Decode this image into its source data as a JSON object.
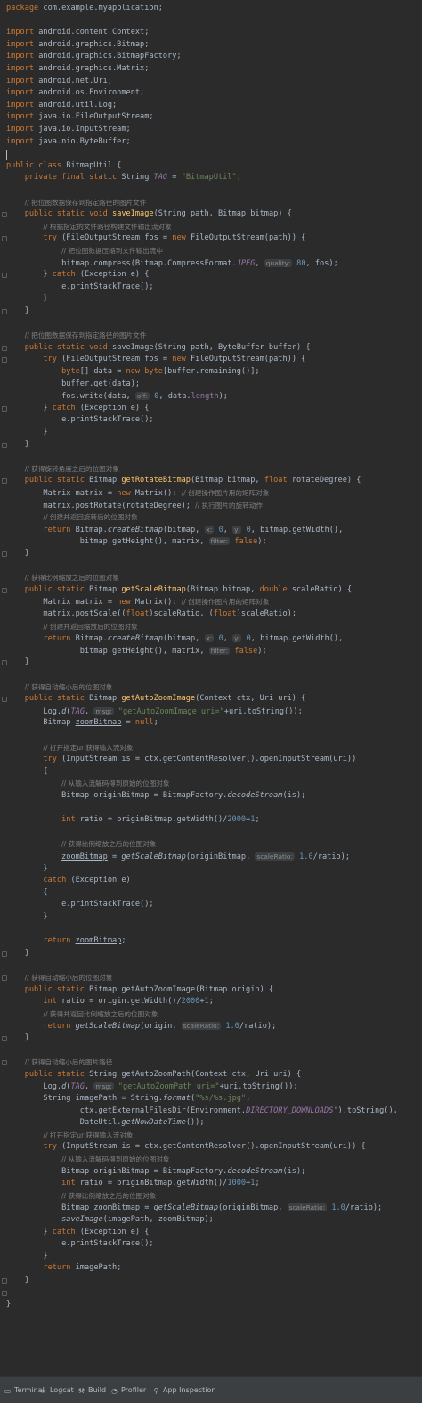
{
  "code_lines": [
    [
      [
        "kw",
        "package "
      ],
      [
        "",
        "com.example.myapplication;"
      ]
    ],
    [],
    [
      [
        "kw",
        "import "
      ],
      [
        "",
        "android.content.Context;"
      ]
    ],
    [
      [
        "kw",
        "import "
      ],
      [
        "",
        "android.graphics.Bitmap;"
      ]
    ],
    [
      [
        "kw",
        "import "
      ],
      [
        "",
        "android.graphics.BitmapFactory;"
      ]
    ],
    [
      [
        "kw",
        "import "
      ],
      [
        "",
        "android.graphics.Matrix;"
      ]
    ],
    [
      [
        "kw",
        "import "
      ],
      [
        "",
        "android.net.Uri;"
      ]
    ],
    [
      [
        "kw",
        "import "
      ],
      [
        "",
        "android.os.Environment;"
      ]
    ],
    [
      [
        "kw",
        "import "
      ],
      [
        "",
        "android.util.Log;"
      ]
    ],
    [
      [
        "kw",
        "import "
      ],
      [
        "",
        "java.io.FileOutputStream;"
      ]
    ],
    [
      [
        "kw",
        "import "
      ],
      [
        "",
        "java.io.InputStream;"
      ]
    ],
    [
      [
        "kw",
        "import "
      ],
      [
        "",
        "java.nio.ByteBuffer;"
      ]
    ],
    [],
    [
      [
        "kw",
        "public class "
      ],
      [
        "",
        "BitmapUtil {"
      ]
    ],
    [
      [
        "",
        "    "
      ],
      [
        "kw",
        "private final static "
      ],
      [
        "",
        "String "
      ],
      [
        "cst",
        "TAG"
      ],
      [
        "",
        " = "
      ],
      [
        "str",
        "\"BitmapUtil\""
      ],
      [
        "kw",
        ";"
      ]
    ],
    [],
    [
      [
        "",
        "    "
      ],
      [
        "cm",
        "// 把位图数据保存到指定路径的图片文件"
      ]
    ],
    [
      [
        "",
        "    "
      ],
      [
        "kw",
        "public static void "
      ],
      [
        "fn",
        "saveImage"
      ],
      [
        "",
        "(String path, Bitmap bitmap) {"
      ]
    ],
    [
      [
        "",
        "        "
      ],
      [
        "cm",
        "// 根据指定的文件路径构建文件输出流对象"
      ]
    ],
    [
      [
        "",
        "        "
      ],
      [
        "kw",
        "try "
      ],
      [
        "",
        "(FileOutputStream fos = "
      ],
      [
        "kw",
        "new "
      ],
      [
        "",
        "FileOutputStream(path)) {"
      ]
    ],
    [
      [
        "",
        "            "
      ],
      [
        "cm",
        "// 把位图数据压缩到文件输出流中"
      ]
    ],
    [
      [
        "",
        "            "
      ],
      [
        "",
        "bitmap.compress(Bitmap.CompressFormat."
      ],
      [
        "cst",
        "JPEG"
      ],
      [
        "",
        ", "
      ],
      [
        "hint",
        "quality:"
      ],
      [
        "num",
        " 80"
      ],
      [
        "",
        ", fos);"
      ]
    ],
    [
      [
        "",
        "        "
      ],
      [
        "",
        "} "
      ],
      [
        "kw",
        "catch "
      ],
      [
        "",
        "(Exception e) {"
      ]
    ],
    [
      [
        "",
        "            "
      ],
      [
        "",
        "e.printStackTrace();"
      ]
    ],
    [
      [
        "",
        "        "
      ],
      [
        "",
        "}"
      ]
    ],
    [
      [
        "",
        "    "
      ],
      [
        "",
        "}"
      ]
    ],
    [],
    [
      [
        "",
        "    "
      ],
      [
        "cm",
        "// 把位图数据保存到指定路径的图片文件"
      ]
    ],
    [
      [
        "",
        "    "
      ],
      [
        "kw",
        "public static void "
      ],
      [
        "",
        "saveImage(String path, ByteBuffer buffer) {"
      ]
    ],
    [
      [
        "",
        "        "
      ],
      [
        "kw",
        "try "
      ],
      [
        "",
        "(FileOutputStream fos = "
      ],
      [
        "kw",
        "new "
      ],
      [
        "",
        "FileOutputStream(path)) {"
      ]
    ],
    [
      [
        "",
        "            "
      ],
      [
        "kw",
        "byte"
      ],
      [
        "",
        "[] data = "
      ],
      [
        "kw",
        "new byte"
      ],
      [
        "",
        "[buffer.remaining()];"
      ]
    ],
    [
      [
        "",
        "            "
      ],
      [
        "",
        "buffer.get(data);"
      ]
    ],
    [
      [
        "",
        "            "
      ],
      [
        "",
        "fos.write(data, "
      ],
      [
        "hint",
        "off:"
      ],
      [
        "num",
        " 0"
      ],
      [
        "",
        ", data."
      ],
      [
        "fld",
        "length"
      ],
      [
        "",
        ");"
      ]
    ],
    [
      [
        "",
        "        "
      ],
      [
        "",
        "} "
      ],
      [
        "kw",
        "catch "
      ],
      [
        "",
        "(Exception e) {"
      ]
    ],
    [
      [
        "",
        "            "
      ],
      [
        "",
        "e.printStackTrace();"
      ]
    ],
    [
      [
        "",
        "        "
      ],
      [
        "",
        "}"
      ]
    ],
    [
      [
        "",
        "    "
      ],
      [
        "",
        "}"
      ]
    ],
    [],
    [
      [
        "",
        "    "
      ],
      [
        "cm",
        "// 获得旋转角度之后的位图对象"
      ]
    ],
    [
      [
        "",
        "    "
      ],
      [
        "kw",
        "public static "
      ],
      [
        "",
        "Bitmap "
      ],
      [
        "fn",
        "getRotateBitmap"
      ],
      [
        "",
        "(Bitmap bitmap, "
      ],
      [
        "kw",
        "float "
      ],
      [
        "",
        "rotateDegree) {"
      ]
    ],
    [
      [
        "",
        "        "
      ],
      [
        "",
        "Matrix matrix = "
      ],
      [
        "kw",
        "new "
      ],
      [
        "",
        "Matrix(); "
      ],
      [
        "cm",
        "// 创建操作图片用的矩阵对象"
      ]
    ],
    [
      [
        "",
        "        "
      ],
      [
        "",
        "matrix.postRotate(rotateDegree); "
      ],
      [
        "cm",
        "// 执行图片的旋转动作"
      ]
    ],
    [
      [
        "",
        "        "
      ],
      [
        "cm",
        "// 创建并返回旋转后的位图对象"
      ]
    ],
    [
      [
        "",
        "        "
      ],
      [
        "kw",
        "return "
      ],
      [
        "",
        "Bitmap."
      ],
      [
        "it",
        "createBitmap"
      ],
      [
        "",
        "(bitmap, "
      ],
      [
        "hint",
        "x:"
      ],
      [
        "num",
        " 0"
      ],
      [
        "",
        ", "
      ],
      [
        "hint",
        "y:"
      ],
      [
        "num",
        " 0"
      ],
      [
        "",
        ", bitmap.getWidth(),"
      ]
    ],
    [
      [
        "",
        "                "
      ],
      [
        "",
        "bitmap.getHeight(), matrix, "
      ],
      [
        "hint",
        "filter:"
      ],
      [
        "kw",
        " false"
      ],
      [
        "",
        ");"
      ]
    ],
    [
      [
        "",
        "    "
      ],
      [
        "",
        "}"
      ]
    ],
    [],
    [
      [
        "",
        "    "
      ],
      [
        "cm",
        "// 获得比例缩放之后的位图对象"
      ]
    ],
    [
      [
        "",
        "    "
      ],
      [
        "kw",
        "public static "
      ],
      [
        "",
        "Bitmap "
      ],
      [
        "fn",
        "getScaleBitmap"
      ],
      [
        "",
        "(Bitmap bitmap, "
      ],
      [
        "kw",
        "double "
      ],
      [
        "",
        "scaleRatio) {"
      ]
    ],
    [
      [
        "",
        "        "
      ],
      [
        "",
        "Matrix matrix = "
      ],
      [
        "kw",
        "new "
      ],
      [
        "",
        "Matrix(); "
      ],
      [
        "cm",
        "// 创建操作图片用的矩阵对象"
      ]
    ],
    [
      [
        "",
        "        "
      ],
      [
        "",
        "matrix.postScale(("
      ],
      [
        "kw",
        "float"
      ],
      [
        "",
        ")scaleRatio, ("
      ],
      [
        "kw",
        "float"
      ],
      [
        "",
        ")scaleRatio);"
      ]
    ],
    [
      [
        "",
        "        "
      ],
      [
        "cm",
        "// 创建并返回缩放后的位图对象"
      ]
    ],
    [
      [
        "",
        "        "
      ],
      [
        "kw",
        "return "
      ],
      [
        "",
        "Bitmap."
      ],
      [
        "it",
        "createBitmap"
      ],
      [
        "",
        "(bitmap, "
      ],
      [
        "hint",
        "x:"
      ],
      [
        "num",
        " 0"
      ],
      [
        "",
        ", "
      ],
      [
        "hint",
        "y:"
      ],
      [
        "num",
        " 0"
      ],
      [
        "",
        ", bitmap.getWidth(),"
      ]
    ],
    [
      [
        "",
        "                "
      ],
      [
        "",
        "bitmap.getHeight(), matrix, "
      ],
      [
        "hint",
        "filter:"
      ],
      [
        "kw",
        " false"
      ],
      [
        "",
        ");"
      ]
    ],
    [
      [
        "",
        "    "
      ],
      [
        "",
        "}"
      ]
    ],
    [],
    [
      [
        "",
        "    "
      ],
      [
        "cm",
        "// 获得自动缩小后的位图对象"
      ]
    ],
    [
      [
        "",
        "    "
      ],
      [
        "kw",
        "public static "
      ],
      [
        "",
        "Bitmap "
      ],
      [
        "fn",
        "getAutoZoomImage"
      ],
      [
        "",
        "(Context ctx, Uri uri) {"
      ]
    ],
    [
      [
        "",
        "        "
      ],
      [
        "",
        "Log."
      ],
      [
        "it",
        "d"
      ],
      [
        "",
        "("
      ],
      [
        "cst",
        "TAG"
      ],
      [
        "",
        ", "
      ],
      [
        "hint",
        "msg:"
      ],
      [
        "str",
        " \"getAutoZoomImage uri=\""
      ],
      [
        "",
        "+uri.toString());"
      ]
    ],
    [
      [
        "",
        "        "
      ],
      [
        "",
        "Bitmap "
      ],
      [
        "ul",
        "zoomBitmap"
      ],
      [
        "",
        " = "
      ],
      [
        "kw",
        "null"
      ],
      [
        "",
        ";"
      ]
    ],
    [],
    [
      [
        "",
        "        "
      ],
      [
        "cm",
        "// 打开指定uri获得输入流对象"
      ]
    ],
    [
      [
        "",
        "        "
      ],
      [
        "kw",
        "try "
      ],
      [
        "",
        "(InputStream is = ctx.getContentResolver().openInputStream(uri))"
      ]
    ],
    [
      [
        "",
        "        "
      ],
      [
        "",
        "{"
      ]
    ],
    [
      [
        "",
        "            "
      ],
      [
        "cm",
        "// 从输入流解码得到原始的位图对象"
      ]
    ],
    [
      [
        "",
        "            "
      ],
      [
        "",
        "Bitmap originBitmap = BitmapFactory."
      ],
      [
        "it",
        "decodeStream"
      ],
      [
        "",
        "(is);"
      ]
    ],
    [],
    [
      [
        "",
        "            "
      ],
      [
        "kw",
        "int "
      ],
      [
        "",
        "ratio = originBitmap.getWidth()/"
      ],
      [
        "num",
        "2000"
      ],
      [
        "",
        "+"
      ],
      [
        "num",
        "1"
      ],
      [
        "",
        ";"
      ]
    ],
    [],
    [
      [
        "",
        "            "
      ],
      [
        "cm",
        "// 获得比例缩放之后的位图对象"
      ]
    ],
    [
      [
        "",
        "            "
      ],
      [
        "ul",
        "zoomBitmap"
      ],
      [
        "",
        " = "
      ],
      [
        "it",
        "getScaleBitmap"
      ],
      [
        "",
        "(originBitmap, "
      ],
      [
        "hint",
        "scaleRatio:"
      ],
      [
        "num",
        " 1.0"
      ],
      [
        "",
        "/ratio);"
      ]
    ],
    [
      [
        "",
        "        "
      ],
      [
        "",
        "}"
      ]
    ],
    [
      [
        "",
        "        "
      ],
      [
        "kw",
        "catch "
      ],
      [
        "",
        "(Exception e)"
      ]
    ],
    [
      [
        "",
        "        "
      ],
      [
        "",
        "{"
      ]
    ],
    [
      [
        "",
        "            "
      ],
      [
        "",
        "e.printStackTrace();"
      ]
    ],
    [
      [
        "",
        "        "
      ],
      [
        "",
        "}"
      ]
    ],
    [],
    [
      [
        "",
        "        "
      ],
      [
        "kw",
        "return "
      ],
      [
        "ul",
        "zoomBitmap"
      ],
      [
        "",
        ";"
      ]
    ],
    [
      [
        "",
        "    "
      ],
      [
        "",
        "}"
      ]
    ],
    [],
    [
      [
        "",
        "    "
      ],
      [
        "cm",
        "// 获得自动缩小后的位图对象"
      ]
    ],
    [
      [
        "",
        "    "
      ],
      [
        "kw",
        "public static "
      ],
      [
        "",
        "Bitmap "
      ],
      [
        "",
        "getAutoZoomImage(Bitmap origin) {"
      ]
    ],
    [
      [
        "",
        "        "
      ],
      [
        "kw",
        "int "
      ],
      [
        "",
        "ratio = origin.getWidth()/"
      ],
      [
        "num",
        "2000"
      ],
      [
        "",
        "+"
      ],
      [
        "num",
        "1"
      ],
      [
        "",
        ";"
      ]
    ],
    [
      [
        "",
        "        "
      ],
      [
        "cm",
        "// 获得并返回比例缩放之后的位图对象"
      ]
    ],
    [
      [
        "",
        "        "
      ],
      [
        "kw",
        "return "
      ],
      [
        "it",
        "getScaleBitmap"
      ],
      [
        "",
        "(origin, "
      ],
      [
        "hint",
        "scaleRatio:"
      ],
      [
        "num",
        " 1.0"
      ],
      [
        "",
        "/ratio);"
      ]
    ],
    [
      [
        "",
        "    "
      ],
      [
        "",
        "}"
      ]
    ],
    [],
    [
      [
        "",
        "    "
      ],
      [
        "cm",
        "// 获得自动缩小后的图片路径"
      ]
    ],
    [
      [
        "",
        "    "
      ],
      [
        "kw",
        "public static "
      ],
      [
        "",
        "String "
      ],
      [
        "",
        "getAutoZoomPath(Context ctx, Uri uri) {"
      ]
    ],
    [
      [
        "",
        "        "
      ],
      [
        "",
        "Log."
      ],
      [
        "it",
        "d"
      ],
      [
        "",
        "("
      ],
      [
        "cst",
        "TAG"
      ],
      [
        "",
        ", "
      ],
      [
        "hint",
        "msg:"
      ],
      [
        "str",
        " \"getAutoZoomPath uri=\""
      ],
      [
        "",
        "+uri.toString());"
      ]
    ],
    [
      [
        "",
        "        "
      ],
      [
        "",
        "String imagePath = String."
      ],
      [
        "it",
        "format"
      ],
      [
        "",
        "("
      ],
      [
        "str",
        "\"%s/%s.jpg\""
      ],
      [
        "",
        ","
      ]
    ],
    [
      [
        "",
        "                "
      ],
      [
        "",
        "ctx.getExternalFilesDir(Environment."
      ],
      [
        "cst",
        "DIRECTORY_DOWNLOADS"
      ],
      [
        "",
        "').toString(),"
      ]
    ],
    [
      [
        "",
        "                "
      ],
      [
        "",
        "DateUtil."
      ],
      [
        "it",
        "getNowDateTime"
      ],
      [
        "",
        "());"
      ]
    ],
    [
      [
        "",
        "        "
      ],
      [
        "cm",
        "// 打开指定uri获得输入流对象"
      ]
    ],
    [
      [
        "",
        "        "
      ],
      [
        "kw",
        "try "
      ],
      [
        "",
        "(InputStream is = ctx.getContentResolver().openInputStream(uri)) {"
      ]
    ],
    [
      [
        "",
        "            "
      ],
      [
        "cm",
        "// 从输入流解码得到原始的位图对象"
      ]
    ],
    [
      [
        "",
        "            "
      ],
      [
        "",
        "Bitmap originBitmap = BitmapFactory."
      ],
      [
        "it",
        "decodeStream"
      ],
      [
        "",
        "(is);"
      ]
    ],
    [
      [
        "",
        "            "
      ],
      [
        "kw",
        "int "
      ],
      [
        "",
        "ratio = originBitmap.getWidth()/"
      ],
      [
        "num",
        "1000"
      ],
      [
        "",
        "+"
      ],
      [
        "num",
        "1"
      ],
      [
        "",
        ";"
      ]
    ],
    [
      [
        "",
        "            "
      ],
      [
        "cm",
        "// 获得比例缩放之后的位图对象"
      ]
    ],
    [
      [
        "",
        "            "
      ],
      [
        "",
        "Bitmap zoomBitmap = "
      ],
      [
        "it",
        "getScaleBitmap"
      ],
      [
        "",
        "(originBitmap, "
      ],
      [
        "hint",
        "scaleRatio:"
      ],
      [
        "num",
        " 1.0"
      ],
      [
        "",
        "/ratio);"
      ]
    ],
    [
      [
        "",
        "            "
      ],
      [
        "it",
        "saveImage"
      ],
      [
        "",
        "(imagePath, zoomBitmap);"
      ]
    ],
    [
      [
        "",
        "        "
      ],
      [
        "",
        "} "
      ],
      [
        "kw",
        "catch "
      ],
      [
        "",
        "(Exception e) {"
      ]
    ],
    [
      [
        "",
        "            "
      ],
      [
        "",
        "e.printStackTrace();"
      ]
    ],
    [
      [
        "",
        "        "
      ],
      [
        "",
        "}"
      ]
    ],
    [
      [
        "",
        "        "
      ],
      [
        "kw",
        "return "
      ],
      [
        "",
        "imagePath;"
      ]
    ],
    [
      [
        "",
        "    "
      ],
      [
        "",
        "}"
      ]
    ],
    [],
    [
      [
        "",
        "}"
      ]
    ]
  ],
  "bottom_tools": [
    {
      "label": "Terminal",
      "icon": "terminal-icon",
      "glyph": "▭"
    },
    {
      "label": "Logcat",
      "icon": "logcat-icon",
      "glyph": "≡"
    },
    {
      "label": "Build",
      "icon": "build-hammer-icon",
      "glyph": "⚒"
    },
    {
      "label": "Profiler",
      "icon": "profiler-gauge-icon",
      "glyph": "◔"
    },
    {
      "label": "App Inspection",
      "icon": "app-inspection-icon",
      "glyph": "⚲"
    }
  ],
  "colors": {
    "background": "#2b2b2b",
    "keyword": "#cc7832",
    "method": "#ffc66d",
    "string": "#6a8759",
    "number": "#6897bb",
    "comment": "#808080",
    "field": "#9876aa",
    "text": "#a9b7c6"
  }
}
